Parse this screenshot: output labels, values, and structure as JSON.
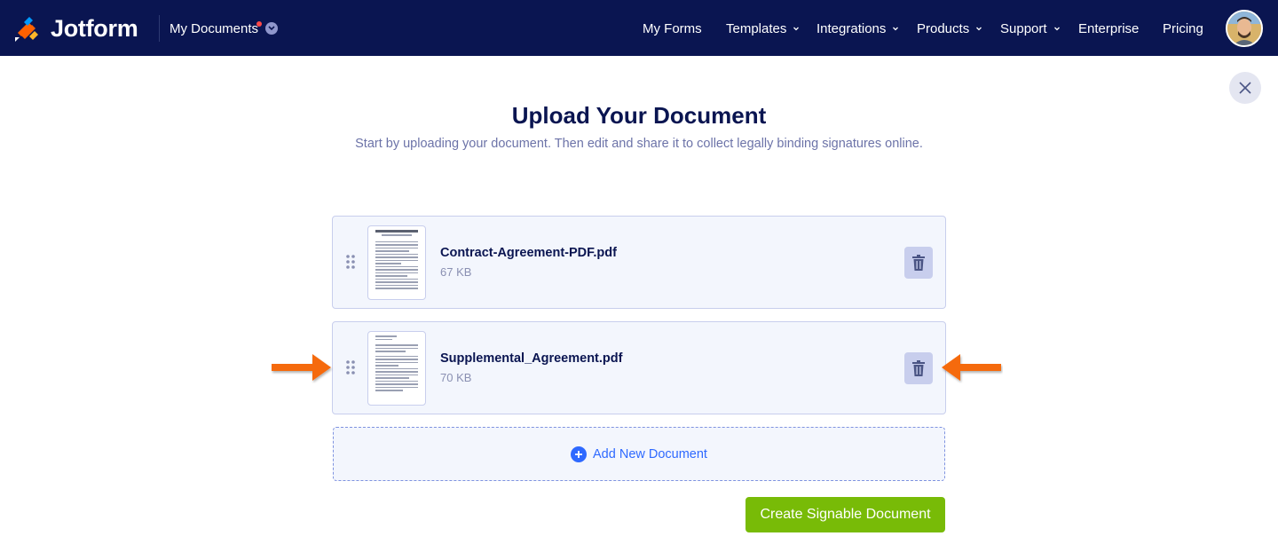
{
  "header": {
    "brand": "Jotform",
    "my_documents": "My Documents",
    "nav": [
      "My Forms",
      "Templates",
      "Integrations",
      "Products",
      "Support",
      "Enterprise",
      "Pricing"
    ]
  },
  "main": {
    "title": "Upload Your Document",
    "subtitle": "Start by uploading your document. Then edit and share it to collect legally binding signatures online.",
    "documents": [
      {
        "name": "Contract-Agreement-PDF.pdf",
        "size": "67 KB"
      },
      {
        "name": "Supplemental_Agreement.pdf",
        "size": "70 KB"
      }
    ],
    "add_label": "Add New Document",
    "create_label": "Create Signable Document"
  },
  "colors": {
    "header_bg": "#0a1551",
    "accent_blue": "#2e69ff",
    "create_green": "#78bb07",
    "arrow_orange": "#f56a0c"
  },
  "icons": [
    "jotform-logo-icon",
    "chevron-down-icon",
    "close-icon",
    "drag-handle-icon",
    "trash-icon",
    "plus-circle-icon",
    "arrow-right-icon",
    "arrow-left-icon"
  ]
}
